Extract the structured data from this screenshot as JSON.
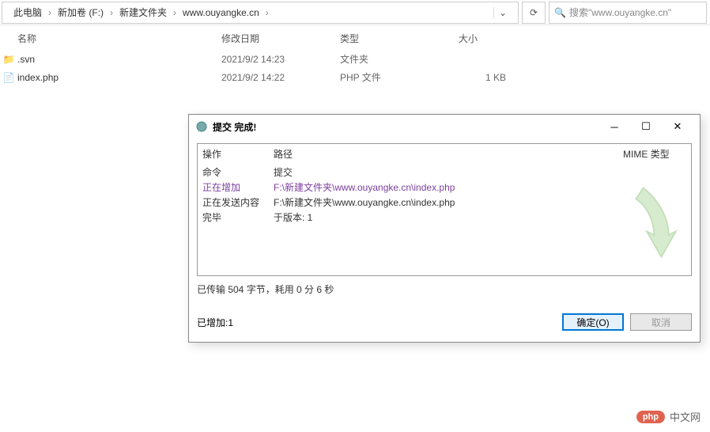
{
  "breadcrumb": {
    "items": [
      "此电脑",
      "新加卷 (F:)",
      "新建文件夹",
      "www.ouyangke.cn"
    ],
    "search_placeholder": "搜索\"www.ouyangke.cn\""
  },
  "columns": {
    "name": "名称",
    "date": "修改日期",
    "type": "类型",
    "size": "大小"
  },
  "files": [
    {
      "icon": "folder",
      "name": ".svn",
      "date": "2021/9/2 14:23",
      "type": "文件夹",
      "size": ""
    },
    {
      "icon": "php",
      "name": "index.php",
      "date": "2021/9/2 14:22",
      "type": "PHP 文件",
      "size": "1 KB"
    }
  ],
  "dialog": {
    "title": "提交 完成!",
    "log_headers": {
      "op": "操作",
      "path": "路径",
      "mime": "MIME 类型"
    },
    "rows": [
      {
        "cls": "cmd",
        "op": "命令",
        "path": "提交"
      },
      {
        "cls": "add",
        "op": "正在增加",
        "path": "F:\\新建文件夹\\www.ouyangke.cn\\index.php"
      },
      {
        "cls": "send",
        "op": "正在发送内容",
        "path": "F:\\新建文件夹\\www.ouyangke.cn\\index.php"
      },
      {
        "cls": "done",
        "op": "完毕",
        "path": "于版本: 1"
      }
    ],
    "stats": "已传输 504 字节，耗用 0 分 6 秒",
    "added": "已增加:1",
    "ok": "确定(O)",
    "cancel": "取消"
  },
  "watermark": {
    "badge": "php",
    "text": "中文网"
  }
}
